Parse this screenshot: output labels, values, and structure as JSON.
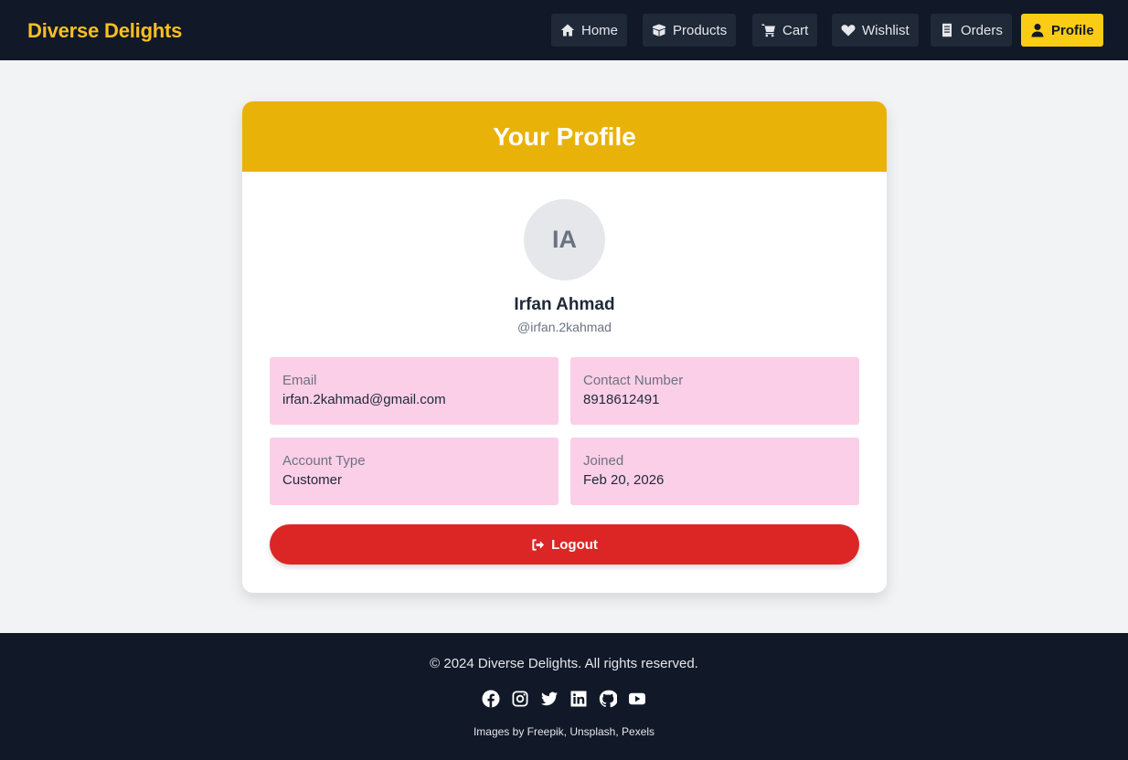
{
  "brand": "Diverse Delights",
  "nav": {
    "items": [
      {
        "label": "Home",
        "icon": "home-icon"
      },
      {
        "label": "Products",
        "icon": "box-icon"
      },
      {
        "label": "Cart",
        "icon": "cart-icon"
      },
      {
        "label": "Wishlist",
        "icon": "heart-icon"
      },
      {
        "label": "Orders",
        "icon": "receipt-icon"
      },
      {
        "label": "Profile",
        "icon": "user-icon",
        "active": true
      }
    ]
  },
  "profile": {
    "title": "Your Profile",
    "initials": "IA",
    "name": "Irfan Ahmad",
    "handle": "@irfan.2kahmad",
    "fields": [
      {
        "label": "Email",
        "value": "irfan.2kahmad@gmail.com"
      },
      {
        "label": "Contact Number",
        "value": "8918612491"
      },
      {
        "label": "Account Type",
        "value": "Customer"
      },
      {
        "label": "Joined",
        "value": "Feb 20, 2026"
      }
    ],
    "logout_label": "Logout"
  },
  "footer": {
    "copyright": "© 2024 Diverse Delights. All rights reserved.",
    "socials": [
      "facebook-icon",
      "instagram-icon",
      "twitter-icon",
      "linkedin-icon",
      "github-icon",
      "youtube-icon"
    ],
    "credits": "Images by Freepik, Unsplash, Pexels"
  },
  "colors": {
    "navbar_bg": "#111827",
    "brand": "#fbbf24",
    "active_nav": "#facc15",
    "header_bg": "#e9b209",
    "info_box_bg": "#fbcfe8",
    "logout_bg": "#dc2626"
  }
}
